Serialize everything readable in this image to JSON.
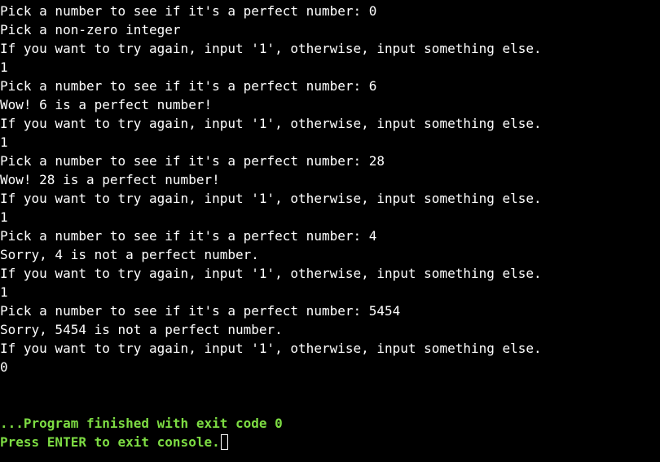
{
  "console": {
    "lines": [
      "Pick a number to see if it's a perfect number: 0",
      "Pick a non-zero integer",
      "If you want to try again, input '1', otherwise, input something else.",
      "1",
      "Pick a number to see if it's a perfect number: 6",
      "Wow! 6 is a perfect number!",
      "If you want to try again, input '1', otherwise, input something else.",
      "1",
      "Pick a number to see if it's a perfect number: 28",
      "Wow! 28 is a perfect number!",
      "If you want to try again, input '1', otherwise, input something else.",
      "1",
      "Pick a number to see if it's a perfect number: 4",
      "Sorry, 4 is not a perfect number.",
      "If you want to try again, input '1', otherwise, input something else.",
      "1",
      "Pick a number to see if it's a perfect number: 5454",
      "Sorry, 5454 is not a perfect number.",
      "If you want to try again, input '1', otherwise, input something else.",
      "0"
    ],
    "exit_message": "...Program finished with exit code 0",
    "prompt_message": "Press ENTER to exit console."
  },
  "colors": {
    "background": "#000000",
    "text": "#ffffff",
    "status": "#7ddc43"
  }
}
